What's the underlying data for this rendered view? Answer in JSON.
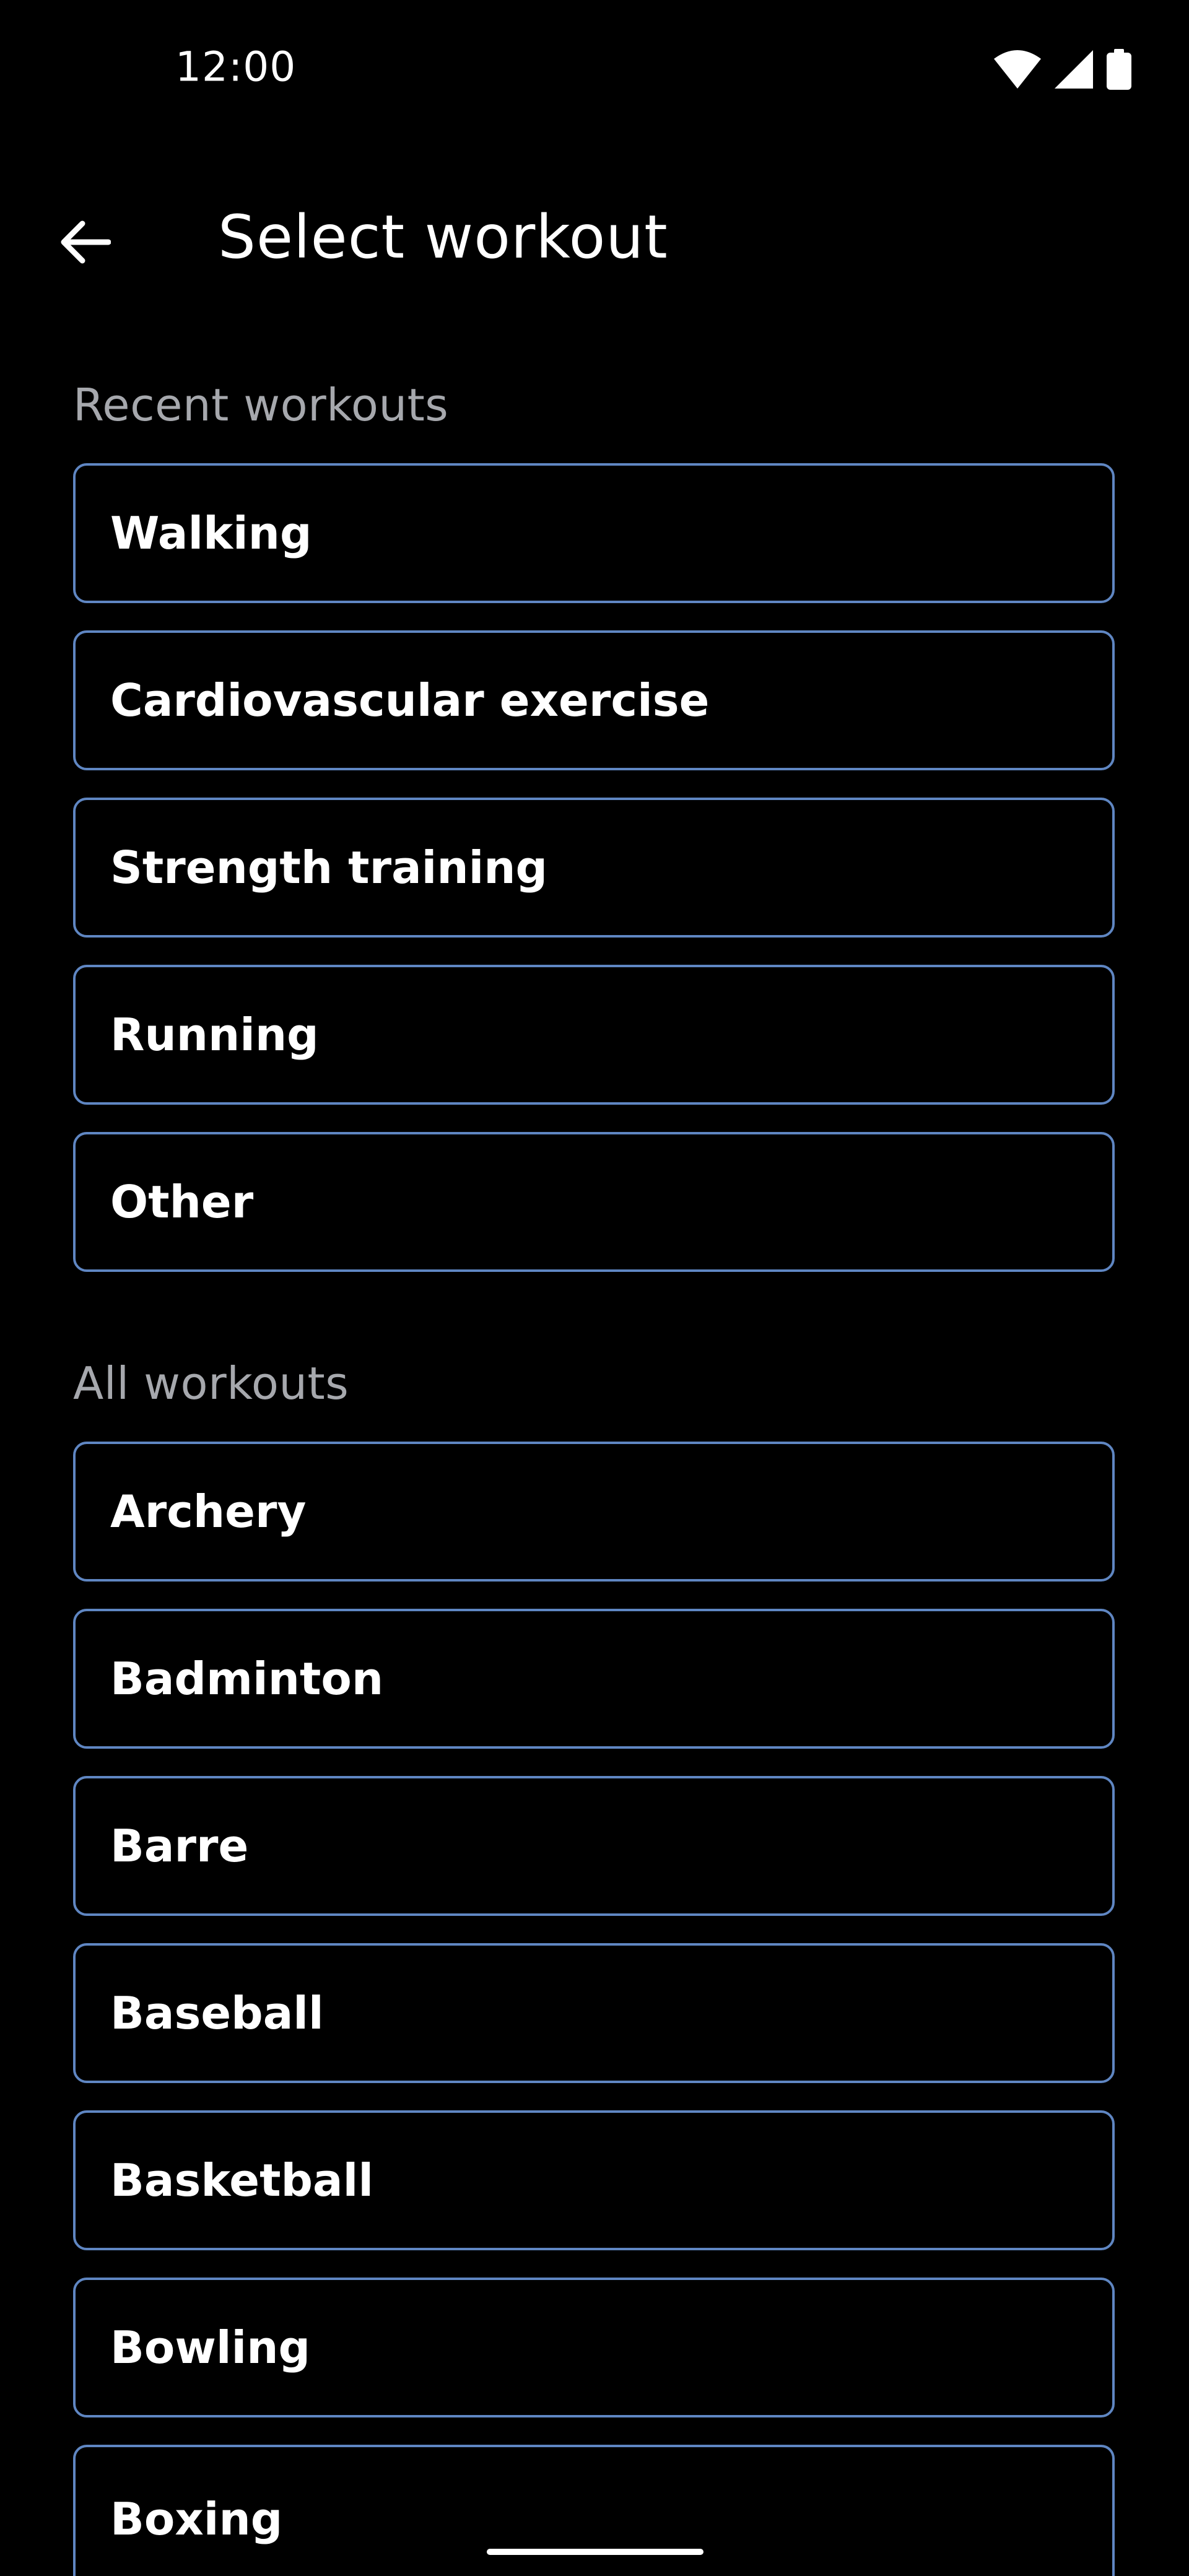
{
  "status_bar": {
    "time": "12:00",
    "icons": [
      "wifi-icon",
      "cellular-signal-icon",
      "battery-icon"
    ]
  },
  "app_bar": {
    "back_icon": "arrow-left-icon",
    "title": "Select workout"
  },
  "recent_section": {
    "header": "Recent workouts",
    "items": [
      "Walking",
      "Cardiovascular exercise",
      "Strength training",
      "Running",
      "Other"
    ]
  },
  "all_section": {
    "header": "All workouts",
    "items": [
      "Archery",
      "Badminton",
      "Barre",
      "Baseball",
      "Basketball",
      "Bowling",
      "Boxing"
    ]
  },
  "colors": {
    "background": "#000000",
    "card_border": "#5f86c2",
    "section_header": "#a6a8ad",
    "text": "#ffffff"
  }
}
